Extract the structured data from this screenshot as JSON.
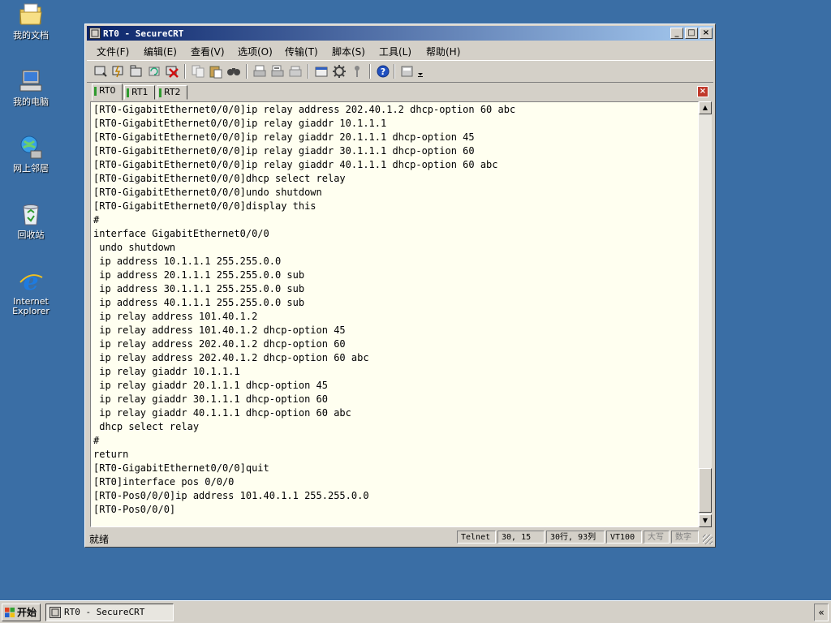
{
  "desktop": {
    "icons": [
      {
        "label": "我的文档",
        "icon": "my-documents-icon"
      },
      {
        "label": "我的电脑",
        "icon": "my-computer-icon"
      },
      {
        "label": "网上邻居",
        "icon": "network-places-icon"
      },
      {
        "label": "回收站",
        "icon": "recycle-bin-icon"
      },
      {
        "label": "Internet",
        "label2": "Explorer",
        "icon": "internet-explorer-icon"
      }
    ]
  },
  "window": {
    "title": "RT0 - SecureCRT",
    "minimize": "_",
    "maximize": "□",
    "close": "×",
    "menu": [
      "文件(F)",
      "编辑(E)",
      "查看(V)",
      "选项(O)",
      "传输(T)",
      "脚本(S)",
      "工具(L)",
      "帮助(H)"
    ],
    "tabs": [
      "RT0",
      "RT1",
      "RT2"
    ],
    "active_tab": "RT0",
    "tab_close": "×",
    "terminal_lines": [
      "[RT0-GigabitEthernet0/0/0]ip relay address 202.40.1.2 dhcp-option 60 abc",
      "[RT0-GigabitEthernet0/0/0]ip relay giaddr 10.1.1.1",
      "[RT0-GigabitEthernet0/0/0]ip relay giaddr 20.1.1.1 dhcp-option 45",
      "[RT0-GigabitEthernet0/0/0]ip relay giaddr 30.1.1.1 dhcp-option 60",
      "[RT0-GigabitEthernet0/0/0]ip relay giaddr 40.1.1.1 dhcp-option 60 abc",
      "[RT0-GigabitEthernet0/0/0]dhcp select relay",
      "[RT0-GigabitEthernet0/0/0]undo shutdown",
      "[RT0-GigabitEthernet0/0/0]display this",
      "#",
      "interface GigabitEthernet0/0/0",
      " undo shutdown",
      " ip address 10.1.1.1 255.255.0.0",
      " ip address 20.1.1.1 255.255.0.0 sub",
      " ip address 30.1.1.1 255.255.0.0 sub",
      " ip address 40.1.1.1 255.255.0.0 sub",
      " ip relay address 101.40.1.2",
      " ip relay address 101.40.1.2 dhcp-option 45",
      " ip relay address 202.40.1.2 dhcp-option 60",
      " ip relay address 202.40.1.2 dhcp-option 60 abc",
      " ip relay giaddr 10.1.1.1",
      " ip relay giaddr 20.1.1.1 dhcp-option 45",
      " ip relay giaddr 30.1.1.1 dhcp-option 60",
      " ip relay giaddr 40.1.1.1 dhcp-option 60 abc",
      " dhcp select relay",
      "#",
      "return",
      "[RT0-GigabitEthernet0/0/0]quit",
      "[RT0]interface pos 0/0/0",
      "[RT0-Pos0/0/0]ip address 101.40.1.1 255.255.0.0",
      "[RT0-Pos0/0/0]"
    ],
    "status": {
      "ready": "就绪",
      "protocol": "Telnet",
      "cursor": "30,  15",
      "position": "30行, 93列",
      "emulation": "VT100",
      "caps": "大写",
      "num": "数字"
    }
  },
  "taskbar": {
    "start_label": "开始",
    "task": "RT0 - SecureCRT",
    "tray_toggle": "«"
  },
  "colors": {
    "desktop": "#3a6ea5",
    "title_start": "#0a246a",
    "title_end": "#a6caf0",
    "terminal_bg": "#fffff0"
  }
}
